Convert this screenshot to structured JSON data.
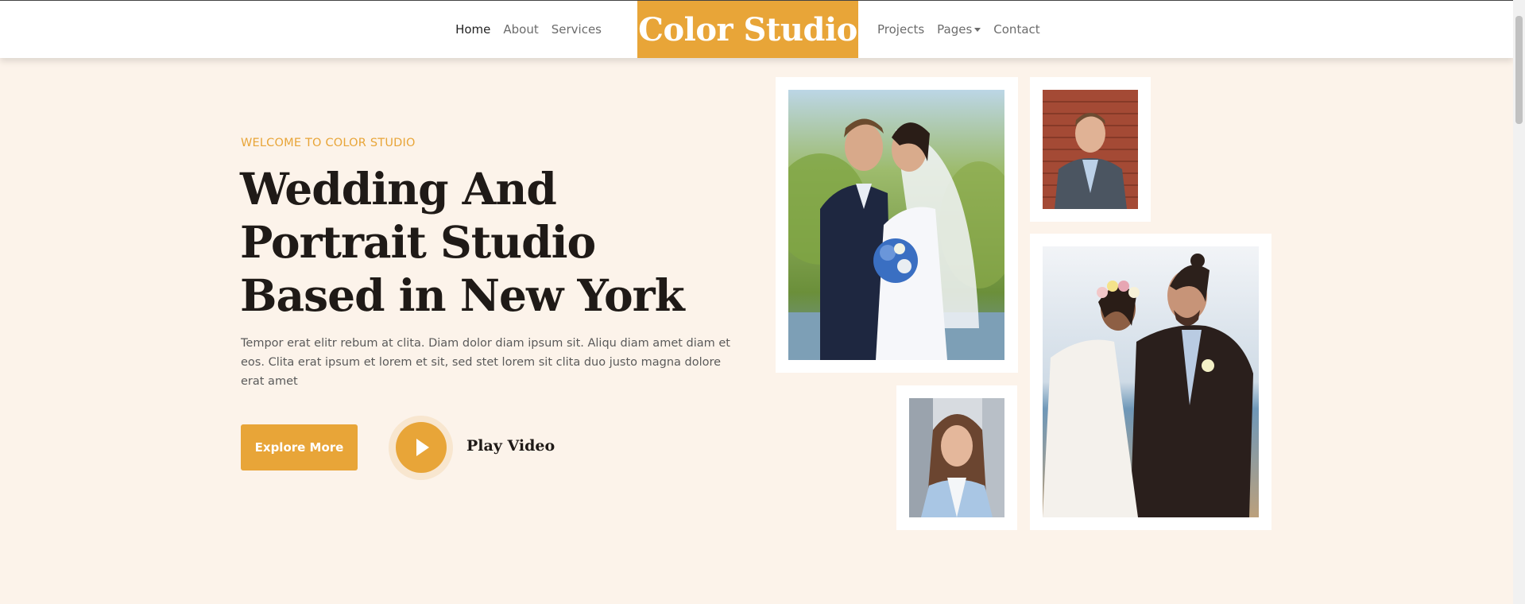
{
  "nav": {
    "left_links": [
      {
        "label": "Home",
        "active": true
      },
      {
        "label": "About",
        "active": false
      },
      {
        "label": "Services",
        "active": false
      }
    ],
    "brand": "Color Studio",
    "right_links": [
      {
        "label": "Projects"
      },
      {
        "label": "Pages",
        "dropdown": true
      },
      {
        "label": "Contact"
      }
    ]
  },
  "hero": {
    "eyebrow": "WELCOME TO COLOR STUDIO",
    "title": "Wedding And Portrait Studio Based in New York",
    "text": "Tempor erat elitr rebum at clita. Diam dolor diam ipsum sit. Aliqu diam amet diam et eos. Clita erat ipsum et lorem et sit, sed stet lorem sit clita duo justo magna dolore erat amet",
    "explore_button": "Explore More",
    "play_label": "Play Video"
  },
  "gallery": {
    "photos": [
      {
        "name": "wedding-couple-bouquet-photo"
      },
      {
        "name": "man-portrait-photo"
      },
      {
        "name": "woman-portrait-photo"
      },
      {
        "name": "couple-flower-crown-photo"
      }
    ]
  },
  "colors": {
    "accent": "#e8a538",
    "background": "#fcf3ea",
    "heading": "#1f1a17",
    "body_text": "#5a5a5a"
  },
  "icons": {
    "play": "play-icon",
    "dropdown": "caret-down-icon"
  }
}
